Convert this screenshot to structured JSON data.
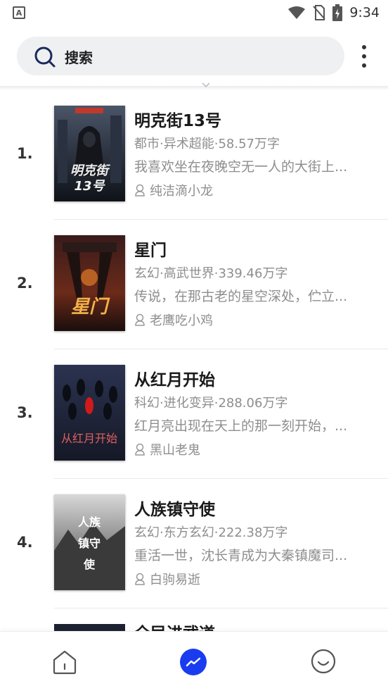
{
  "status_bar": {
    "app_badge": "A",
    "time": "9:34",
    "icons": [
      "wifi-icon",
      "no-sim-icon",
      "battery-charging-icon"
    ]
  },
  "search": {
    "label": "搜索",
    "icon": "search-icon"
  },
  "header": {
    "more_icon": "more-vertical-icon"
  },
  "books": [
    {
      "rank": "1.",
      "title": "明克街13号",
      "meta": "都市·异术超能·58.57万字",
      "desc": "我喜欢坐在夜晚空无一人的大街上...",
      "author": "纯洁滴小龙",
      "cover_text": "明克街13号"
    },
    {
      "rank": "2.",
      "title": "星门",
      "meta": "玄幻·高武世界·339.46万字",
      "desc": "传说，在那古老的星空深处，伫立...",
      "author": "老鹰吃小鸡",
      "cover_text": "星门"
    },
    {
      "rank": "3.",
      "title": "从红月开始",
      "meta": "科幻·进化变异·288.06万字",
      "desc": "红月亮出现在天上的那一刻开始，...",
      "author": "黑山老鬼",
      "cover_text": "从红月开始"
    },
    {
      "rank": "4.",
      "title": "人族镇守使",
      "meta": "玄幻·东方玄幻·222.38万字",
      "desc": "重活一世，沈长青成为大秦镇魔司...",
      "author": "白驹易逝",
      "cover_text": "人族镇守使"
    }
  ],
  "peek_book": {
    "title": "全民进武道"
  },
  "bottom_nav": {
    "items": [
      {
        "icon": "home-icon",
        "active": false
      },
      {
        "icon": "trending-icon",
        "active": true
      },
      {
        "icon": "profile-smile-icon",
        "active": false
      }
    ],
    "active_color": "#1a3cf0"
  },
  "colors": {
    "accent": "#1a3cf0",
    "text_primary": "#1a1a1a",
    "text_secondary": "#8e8e8e",
    "search_bg": "#eef0f2"
  }
}
